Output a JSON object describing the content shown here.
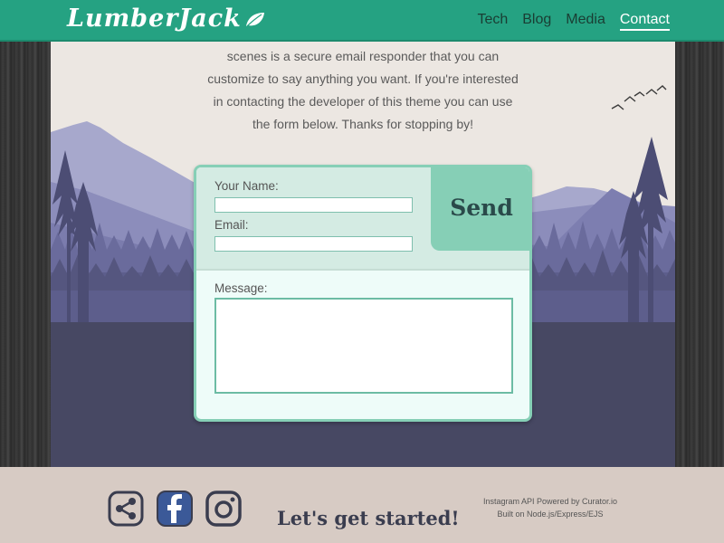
{
  "header": {
    "logo_text": "LumberJack",
    "nav": [
      {
        "label": "Tech"
      },
      {
        "label": "Blog"
      },
      {
        "label": "Media"
      },
      {
        "label": "Contact"
      }
    ],
    "active_nav": "Contact"
  },
  "intro": {
    "lines": [
      "scenes is a secure email responder that you can",
      "customize to say anything you want. If you're interested",
      "in contacting the developer of this theme you can use",
      "the form below. Thanks for stopping by!"
    ]
  },
  "form": {
    "name_label": "Your Name:",
    "name_value": "",
    "email_label": "Email:",
    "email_value": "",
    "message_label": "Message:",
    "message_value": "",
    "send_label": "Send"
  },
  "footer": {
    "icons": [
      "share-icon",
      "facebook-icon",
      "instagram-icon"
    ],
    "cta": "Let's get started!",
    "credit_line1": "Instagram API Powered by Curator.io",
    "credit_line2": "Built on Node.js/Express/EJS"
  },
  "colors": {
    "brand": "#25a282",
    "accent": "#86cfb6",
    "footer_bg": "#d7cbc4",
    "facebook": "#3b5998"
  }
}
